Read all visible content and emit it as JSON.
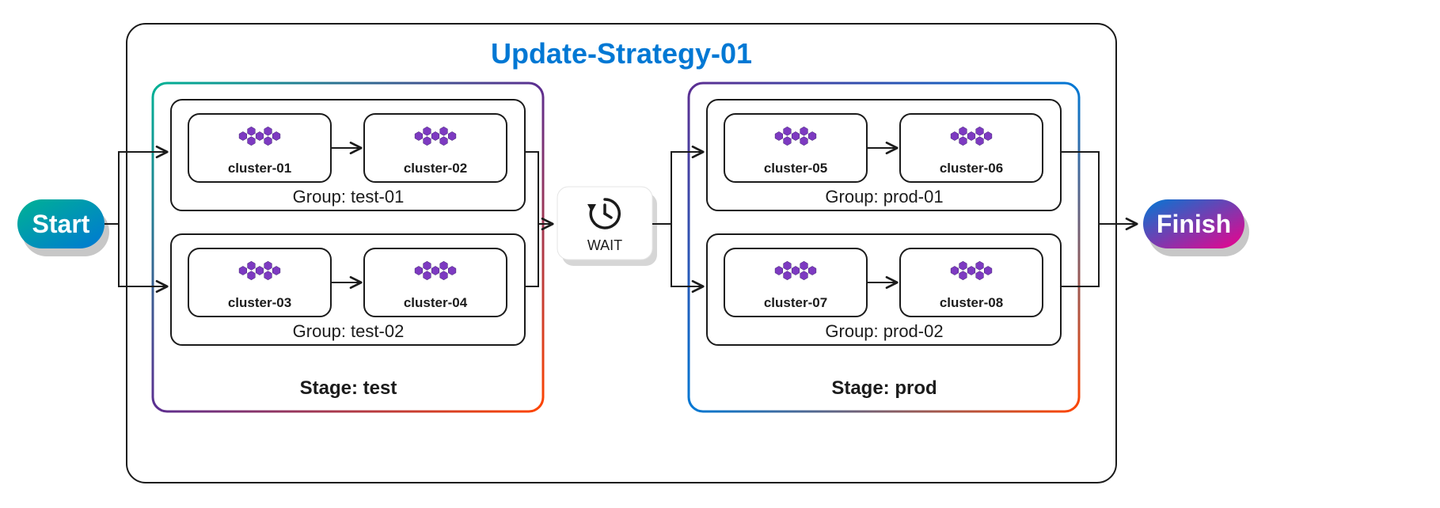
{
  "title": "Update-Strategy-01",
  "start_label": "Start",
  "finish_label": "Finish",
  "wait_label": "WAIT",
  "stages": [
    {
      "label": "Stage: test",
      "groups": [
        {
          "label": "Group: test-01",
          "clusters": [
            "cluster-01",
            "cluster-02"
          ]
        },
        {
          "label": "Group: test-02",
          "clusters": [
            "cluster-03",
            "cluster-04"
          ]
        }
      ]
    },
    {
      "label": "Stage: prod",
      "groups": [
        {
          "label": "Group: prod-01",
          "clusters": [
            "cluster-05",
            "cluster-06"
          ]
        },
        {
          "label": "Group: prod-02",
          "clusters": [
            "cluster-07",
            "cluster-08"
          ]
        }
      ]
    }
  ]
}
